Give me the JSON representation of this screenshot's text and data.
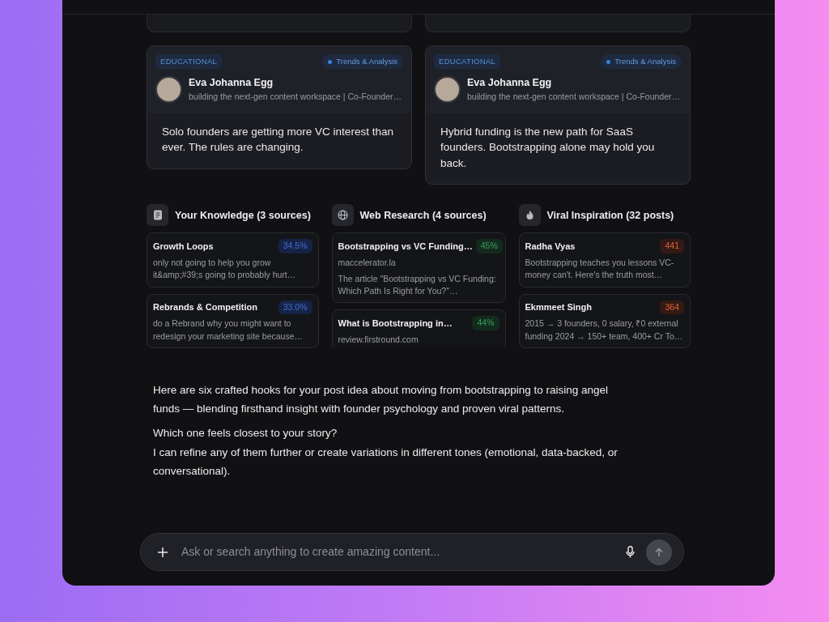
{
  "posts": [
    {
      "category": "EDUCATIONAL",
      "topic": "Trends & Analysis",
      "author": "Eva Johanna Egg",
      "headline": "building the next-gen content workspace | Co-Founder…",
      "text": "Solo founders are getting more VC interest than ever. The rules are changing."
    },
    {
      "category": "EDUCATIONAL",
      "topic": "Trends & Analysis",
      "author": "Eva Johanna Egg",
      "headline": "building the next-gen content workspace | Co-Founder…",
      "text": "Hybrid funding is the new path for SaaS founders. Bootstrapping alone may hold you back."
    }
  ],
  "sources": [
    {
      "kind": "knowledge",
      "title": "Your Knowledge (3 sources)",
      "items": [
        {
          "title": "Growth Loops",
          "score": "34.5%",
          "snippet": "only not going to help you grow it&amp;#39;s going to probably hurt…"
        },
        {
          "title": "Rebrands & Competition",
          "score": "33.0%",
          "snippet": "do a Rebrand why you might want to redesign your marketing site because…"
        }
      ]
    },
    {
      "kind": "web",
      "title": "Web Research (4 sources)",
      "items": [
        {
          "title": "Bootstrapping vs VC Funding…",
          "score": "45%",
          "domain": "maccelerator.la",
          "snippet": "The article \"Bootstrapping vs VC Funding: Which Path Is Right for You?\"…"
        },
        {
          "title": "What is Bootstrapping in…",
          "score": "44%",
          "domain": "review.firstround.com"
        }
      ]
    },
    {
      "kind": "viral",
      "title": "Viral Inspiration (32 posts)",
      "items": [
        {
          "title": "Radha Vyas",
          "score": "441",
          "snippet": "Bootstrapping teaches you lessons VC-money can't. Here's the truth most…"
        },
        {
          "title": "Ekmmeet Singh",
          "score": "364",
          "snippet": "2015 → 3 founders, 0 salary, ₹0 external funding 2024 → 150+ team, 400+ Cr To…"
        }
      ]
    }
  ],
  "reply": [
    "Here are six crafted hooks for your post idea about moving from bootstrapping to raising angel funds — blending firsthand insight with founder psychology and proven viral patterns.",
    "Which one feels closest to your story?\nI can refine any of them further or create variations in different tones (emotional, data-backed, or conversational)."
  ],
  "composer": {
    "placeholder": "Ask or search anything to create amazing content..."
  }
}
